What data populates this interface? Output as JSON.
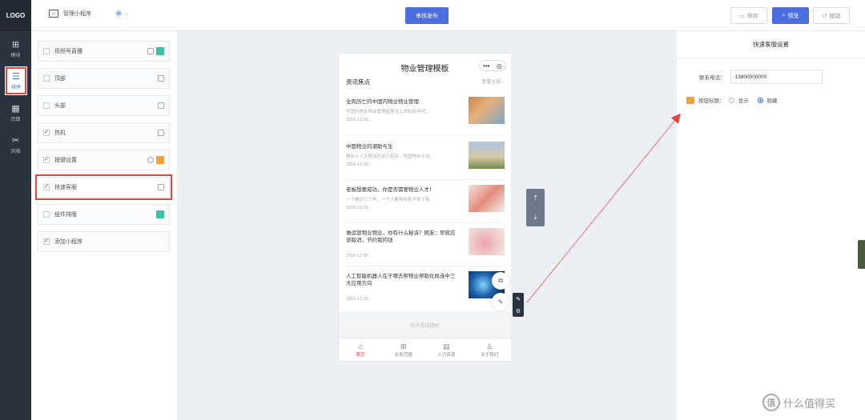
{
  "nav": {
    "logo": "LOGO",
    "items": [
      {
        "label": "模块",
        "icon": "⊞"
      },
      {
        "label": "排序",
        "icon": "☰"
      },
      {
        "label": "页面",
        "icon": "▦"
      },
      {
        "label": "风格",
        "icon": "✂"
      }
    ]
  },
  "topbar": {
    "app_name": "管理小程序",
    "app_icon_text": "◻",
    "switch_icon": "⁜",
    "switch_chevron": "⌵",
    "publish_label": "审核发布",
    "save_label": "保存",
    "preview_label": "预览",
    "undo_label": "撤销"
  },
  "components": [
    {
      "label": "视频号直播",
      "checked": false,
      "badge": "#3fc1a5"
    },
    {
      "label": "顶部",
      "checked": false
    },
    {
      "label": "头部",
      "checked": false
    },
    {
      "label": "热机",
      "checked": true
    },
    {
      "label": "按键设置",
      "checked": true,
      "badge": "#f2a23a"
    },
    {
      "label": "快速客服",
      "checked": true
    },
    {
      "label": "组件排版",
      "checked": false,
      "badge": "#3fc1a5"
    },
    {
      "label": "添加小程序",
      "checked": true
    }
  ],
  "phone": {
    "title": "物业管理模板",
    "capsule_dots": "•••",
    "capsule_close": "◎",
    "section_title": "资讯焦点",
    "section_more": "查看全部 ›",
    "news": [
      {
        "title": "全肉历亡的中国内物业物业管理",
        "desc": "中国内物业物业管理起源于上世纪80年代...",
        "date": "2016-12-05"
      },
      {
        "title": "中国物业的潮助与生",
        "desc": "物业人人大物业的这几百年，中国物业平台...",
        "date": "2016-12-05"
      },
      {
        "title": "老板想要成功，你是否需要物业人才！",
        "desc": "一个做过三个年，一个人都物业和不容下容...",
        "date": "2016-12-05"
      },
      {
        "title": "做运营物业物业，你有什么秘诀？网友：早就应该取消，节约我的钱",
        "desc": "",
        "date": "2016-12-05"
      },
      {
        "title": "人工智能机器人在于哪去帮物业帮助化局连中三大应用方向",
        "desc": "",
        "date": "2016-12-05"
      }
    ],
    "footer_mark": "技术支持提供",
    "tabs": [
      {
        "label": "首页",
        "icon": "⌂"
      },
      {
        "label": "业务范围",
        "icon": "⊞"
      },
      {
        "label": "人力资源",
        "icon": "▤"
      },
      {
        "label": "关于我们",
        "icon": "♙"
      }
    ]
  },
  "float_tools": {
    "up": "⇡",
    "down": "⇣"
  },
  "edit_tools": {
    "edit": "✎",
    "gear": "⚙"
  },
  "phone_side": {
    "share": "⧉",
    "link": "✎"
  },
  "settings": {
    "title": "快速客服设置",
    "phone_label": "联系电话：",
    "phone_value": "13800000000",
    "show_label": "按钮标题：",
    "opt_show": "显示",
    "opt_hide": "隐藏"
  },
  "watermark": {
    "badge": "值",
    "text": "什么值得买"
  },
  "colors": {
    "accent": "#4a6ee0",
    "highlight": "#e5453f",
    "nav_bg": "#2c3340"
  }
}
